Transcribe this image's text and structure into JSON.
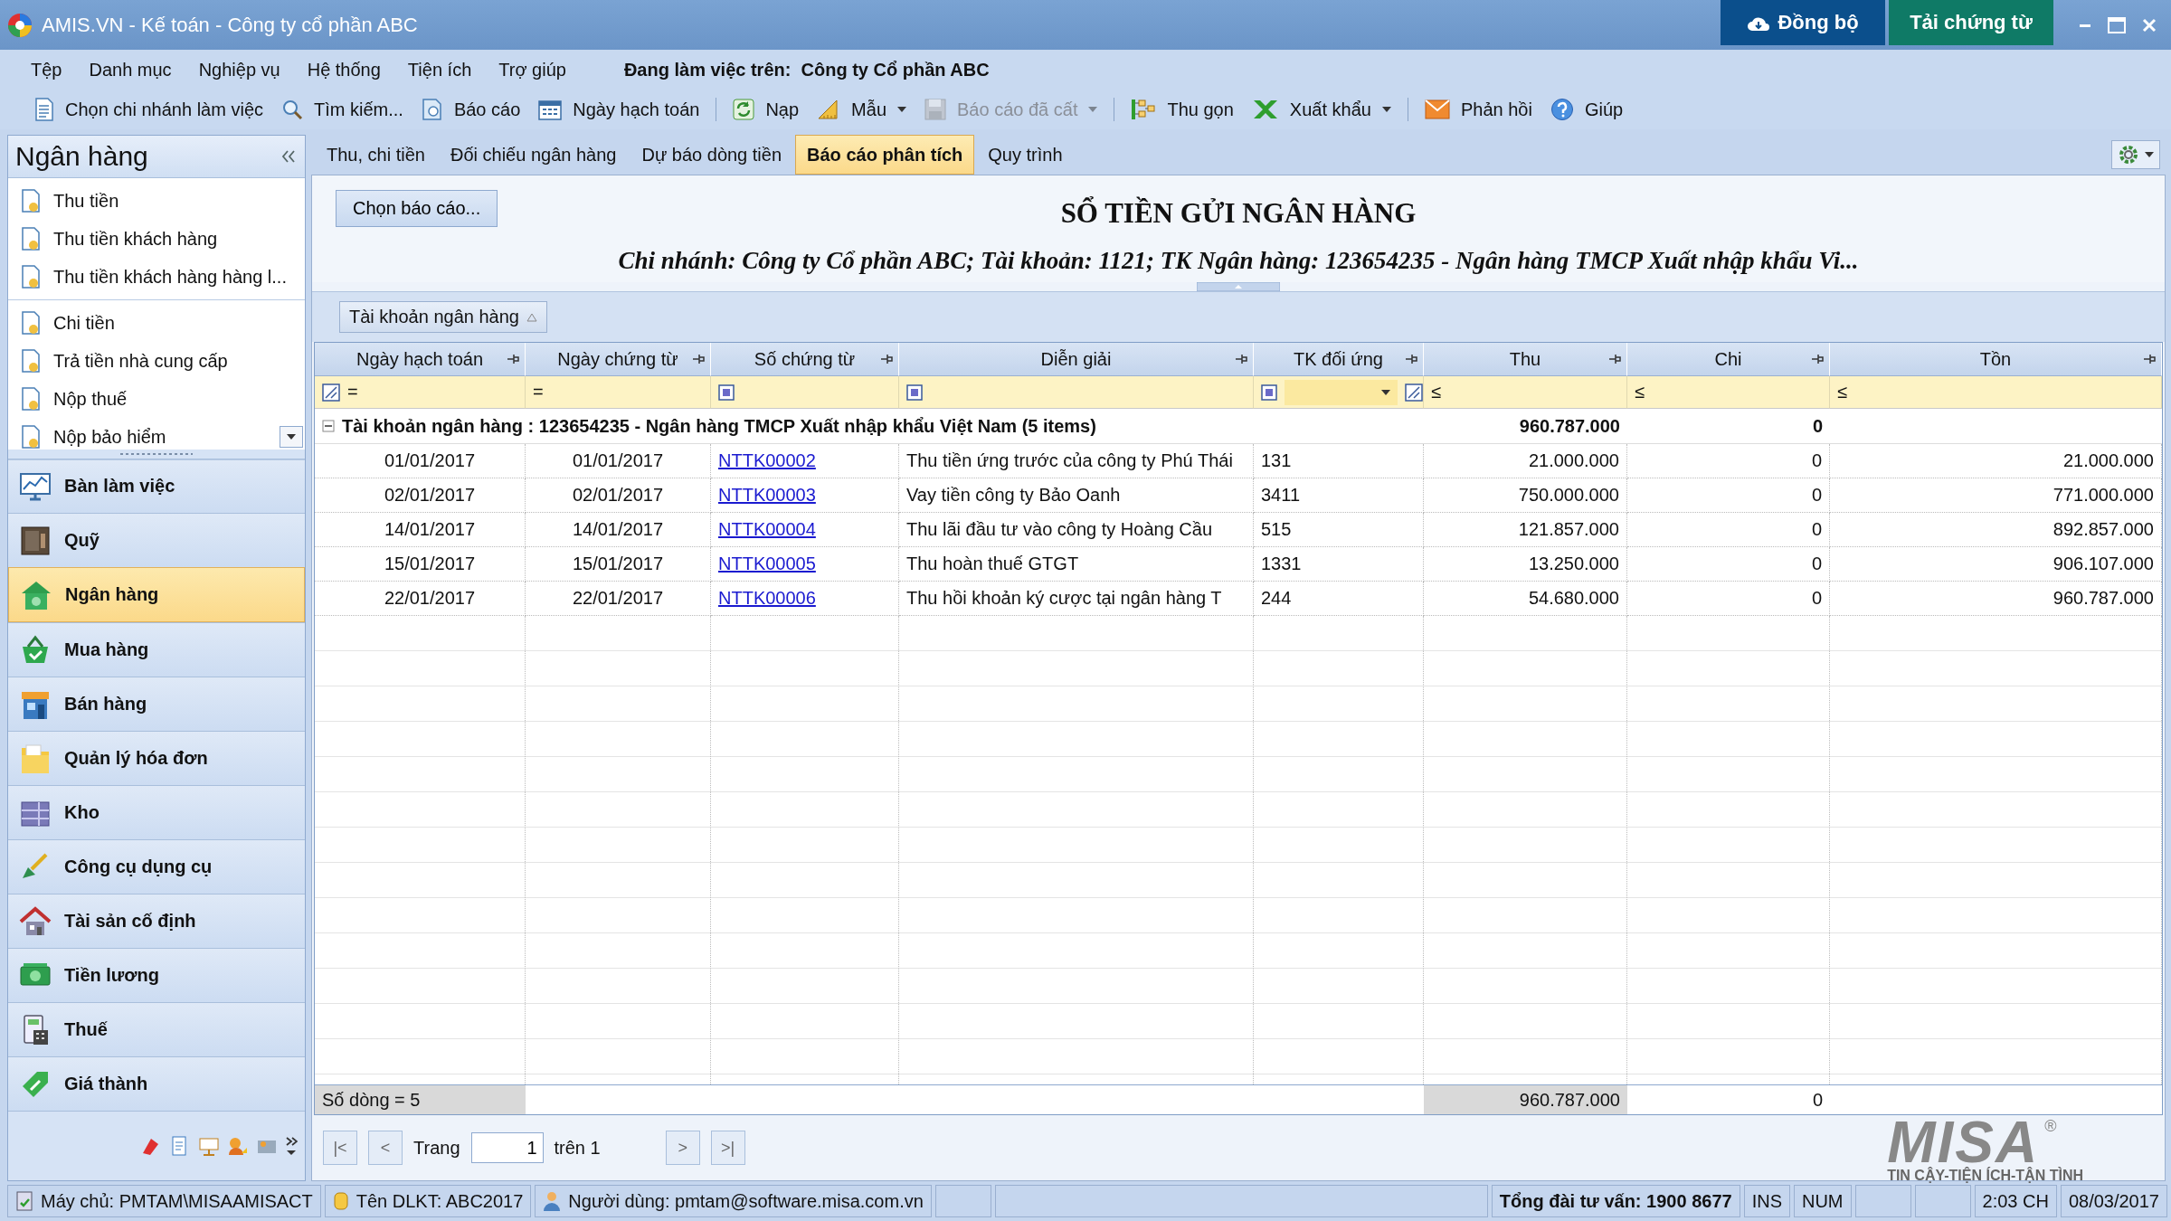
{
  "window": {
    "title": "AMIS.VN - Kế toán - Công ty cổ phần ABC",
    "sync_button": "Đồng bộ",
    "download_button": "Tải chứng từ"
  },
  "menu": {
    "items": [
      "Tệp",
      "Danh mục",
      "Nghiệp vụ",
      "Hệ thống",
      "Tiện ích",
      "Trợ giúp"
    ],
    "working_on": "Đang làm việc trên:  Công ty Cổ phần ABC"
  },
  "toolbar": [
    {
      "label": "Chọn chi nhánh làm việc",
      "disabled": false,
      "dropdown": false
    },
    {
      "label": "Tìm kiếm...",
      "disabled": false,
      "dropdown": false
    },
    {
      "label": "Báo cáo",
      "disabled": false,
      "dropdown": false
    },
    {
      "label": "Ngày hạch toán",
      "disabled": false,
      "dropdown": false
    },
    {
      "label": "Nạp",
      "disabled": false,
      "dropdown": false
    },
    {
      "label": "Mẫu",
      "disabled": false,
      "dropdown": true
    },
    {
      "label": "Báo cáo đã cất",
      "disabled": true,
      "dropdown": true
    },
    {
      "label": "Thu gọn",
      "disabled": false,
      "dropdown": false
    },
    {
      "label": "Xuất khẩu",
      "disabled": false,
      "dropdown": true
    },
    {
      "label": "Phản hồi",
      "disabled": false,
      "dropdown": false
    },
    {
      "label": "Giúp",
      "disabled": false,
      "dropdown": false
    }
  ],
  "sidebar": {
    "title": "Ngân hàng",
    "task_groups": [
      [
        "Thu tiền",
        "Thu tiền khách hàng",
        "Thu tiền khách hàng hàng l..."
      ],
      [
        "Chi tiền",
        "Trả tiền nhà cung cấp",
        "Nộp thuế",
        "Nộp bảo hiểm"
      ]
    ],
    "modules": [
      {
        "label": "Bàn làm việc",
        "selected": false
      },
      {
        "label": "Quỹ",
        "selected": false
      },
      {
        "label": "Ngân hàng",
        "selected": true
      },
      {
        "label": "Mua hàng",
        "selected": false
      },
      {
        "label": "Bán hàng",
        "selected": false
      },
      {
        "label": "Quản lý hóa đơn",
        "selected": false
      },
      {
        "label": "Kho",
        "selected": false
      },
      {
        "label": "Công cụ dụng cụ",
        "selected": false
      },
      {
        "label": "Tài sản cố định",
        "selected": false
      },
      {
        "label": "Tiền lương",
        "selected": false
      },
      {
        "label": "Thuế",
        "selected": false
      },
      {
        "label": "Giá thành",
        "selected": false
      }
    ]
  },
  "tabs": [
    {
      "label": "Thu, chi tiền",
      "selected": false
    },
    {
      "label": "Đối chiếu ngân hàng",
      "selected": false
    },
    {
      "label": "Dự báo dòng tiền",
      "selected": false
    },
    {
      "label": "Báo cáo phân tích",
      "selected": true
    },
    {
      "label": "Quy trình",
      "selected": false
    }
  ],
  "report": {
    "choose_button": "Chọn báo cáo...",
    "title": "SỔ TIỀN GỬI NGÂN HÀNG",
    "subtitle": "Chi nhánh: Công ty Cổ phần ABC; Tài khoản: 1121; TK Ngân hàng: 123654235 - Ngân hàng TMCP Xuất nhập khẩu Vi..."
  },
  "table": {
    "group_by": "Tài khoản ngân hàng",
    "columns": [
      "Ngày hạch toán",
      "Ngày chứng từ",
      "Số chứng từ",
      "Diễn giải",
      "TK đối ứng",
      "Thu",
      "Chi",
      "Tồn"
    ],
    "filters": [
      {
        "kind": "op",
        "op": "="
      },
      {
        "kind": "op",
        "op": "="
      },
      {
        "kind": "checkbox"
      },
      {
        "kind": "checkbox"
      },
      {
        "kind": "dropdown"
      },
      {
        "kind": "op",
        "op": "≤"
      },
      {
        "kind": "op",
        "op": "≤"
      },
      {
        "kind": "op",
        "op": "≤"
      }
    ],
    "group": {
      "label": "Tài khoản ngân hàng : 123654235 - Ngân hàng TMCP Xuất nhập khẩu Việt Nam (5 items)",
      "thu": "960.787.000",
      "chi": "0",
      "expanded": true
    },
    "rows": [
      [
        "01/01/2017",
        "01/01/2017",
        "NTTK00002",
        "Thu tiền ứng trước của công ty Phú Thái",
        "131",
        "21.000.000",
        "0",
        "21.000.000"
      ],
      [
        "02/01/2017",
        "02/01/2017",
        "NTTK00003",
        "Vay tiền công ty Bảo Oanh",
        "3411",
        "750.000.000",
        "0",
        "771.000.000"
      ],
      [
        "14/01/2017",
        "14/01/2017",
        "NTTK00004",
        "Thu lãi đầu tư vào công ty Hoàng Cầu",
        "515",
        "121.857.000",
        "0",
        "892.857.000"
      ],
      [
        "15/01/2017",
        "15/01/2017",
        "NTTK00005",
        "Thu hoàn thuế GTGT",
        "1331",
        "13.250.000",
        "0",
        "906.107.000"
      ],
      [
        "22/01/2017",
        "22/01/2017",
        "NTTK00006",
        "Thu hồi khoản ký cược tại ngân hàng T",
        "244",
        "54.680.000",
        "0",
        "960.787.000"
      ]
    ],
    "footer": {
      "count": "Số dòng = 5",
      "thu": "960.787.000",
      "chi": "0"
    }
  },
  "pager": {
    "first": "|<",
    "prev": "<",
    "page_label": "Trang",
    "page": "1",
    "of": "trên 1",
    "next": ">",
    "last": ">|"
  },
  "logo": {
    "name": "MISA",
    "mark": "®",
    "tagline": "TIN CẬY-TIỆN ÍCH-TẬN TÌNH"
  },
  "status_bar": [
    {
      "text": "Máy chủ: PMTAM\\MISAAMISACT",
      "bold": false
    },
    {
      "text": "Tên DLKT: ABC2017",
      "bold": false
    },
    {
      "text": "Người dùng: pmtam@software.misa.com.vn",
      "bold": false
    },
    {
      "text": "Tổng đài tư vấn: 1900 8677",
      "bold": true
    },
    {
      "text": "INS",
      "bold": false
    },
    {
      "text": "NUM",
      "bold": false
    },
    {
      "text": "2:03 CH",
      "bold": false
    },
    {
      "text": "08/03/2017",
      "bold": false
    }
  ]
}
